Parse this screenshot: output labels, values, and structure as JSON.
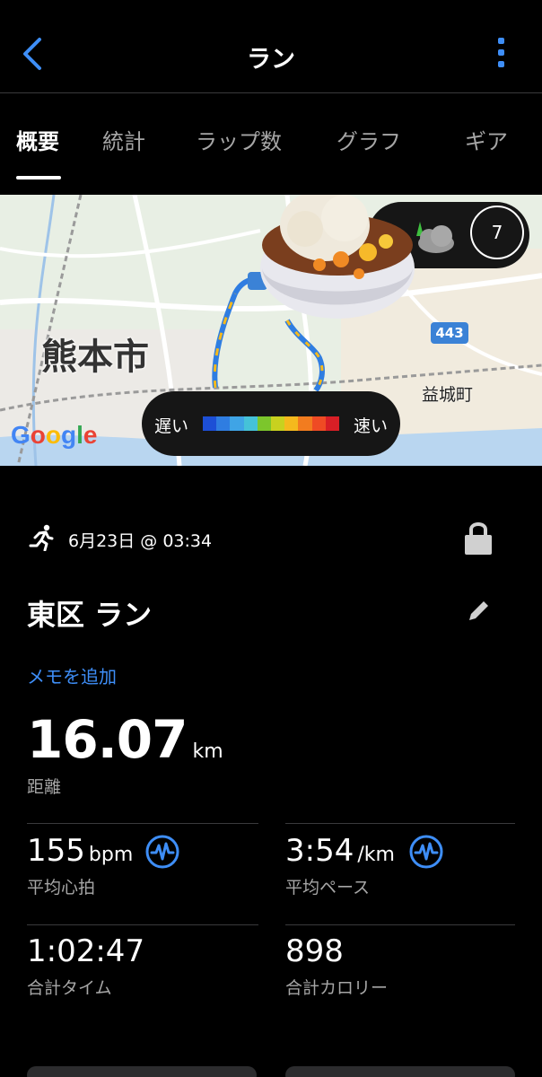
{
  "header": {
    "title": "ラン",
    "back_icon": "chevron-left-icon",
    "more_icon": "vertical-ellipsis-icon",
    "accent_color": "#3e8ef7"
  },
  "tabs": [
    {
      "label": "概要",
      "active": true
    },
    {
      "label": "統計",
      "active": false
    },
    {
      "label": "ラップ数",
      "active": false
    },
    {
      "label": "グラフ",
      "active": false
    },
    {
      "label": "ギア",
      "active": false
    }
  ],
  "map": {
    "city_label": "熊本市",
    "town_label": "益城町",
    "road_badge": "443",
    "google_logo": "Google",
    "legend": {
      "slow": "遅い",
      "fast": "速い",
      "colors": [
        "#1d4fd6",
        "#2f7de1",
        "#3fa4e6",
        "#45c2d8",
        "#7cc62c",
        "#c8d11f",
        "#f5b91d",
        "#f27c1f",
        "#ef4b24",
        "#d81f26"
      ]
    },
    "compass_value": "7",
    "weather_icon": "partly-cloudy-icon",
    "overlay_emoji": "curry-rice-icon"
  },
  "activity": {
    "type_icon": "running-icon",
    "date": "6月23日 @ 03:34",
    "lock_icon": "lock-icon",
    "name": "東区 ラン",
    "edit_icon": "pencil-icon",
    "add_memo": "メモを追加",
    "distance": {
      "value": "16.07",
      "unit": "km",
      "label": "距離"
    }
  },
  "stats": {
    "avg_hr": {
      "value": "155",
      "unit": "bpm",
      "label": "平均心拍"
    },
    "avg_pace": {
      "value": "3:54",
      "unit": "/km",
      "label": "平均ペース"
    },
    "total_time": {
      "value": "1:02:47",
      "label": "合計タイム"
    },
    "calories": {
      "value": "898",
      "label": "合計カロリー"
    }
  }
}
